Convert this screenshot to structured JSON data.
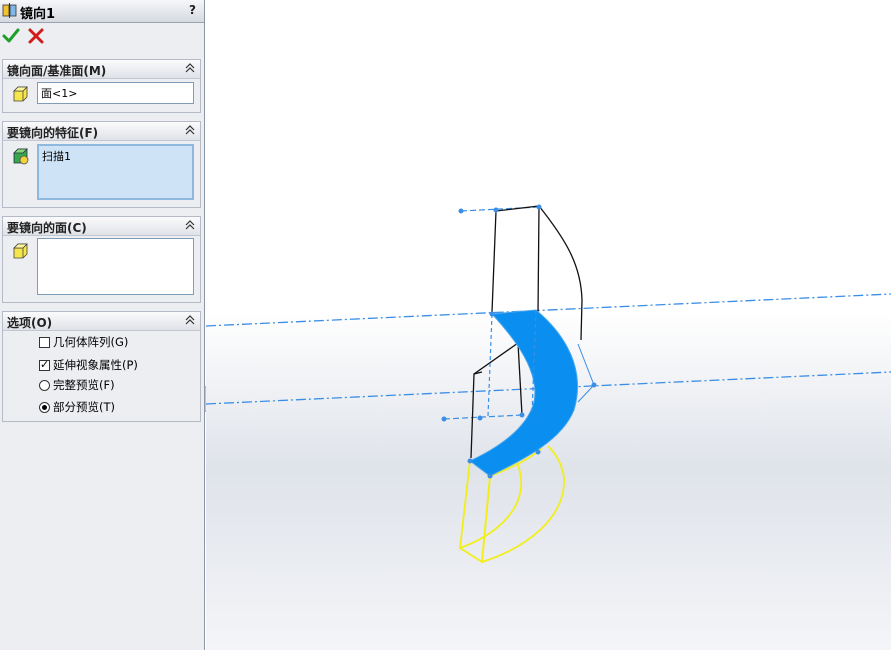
{
  "window": {
    "title": "镜向1",
    "help_label": "?"
  },
  "actions": {
    "ok": "ok-checkmark",
    "cancel": "cancel-x"
  },
  "groups": {
    "mirror_face": {
      "title": "镜向面/基准面(M)",
      "value": "面<1>"
    },
    "features": {
      "title": "要镜向的特征(F)",
      "items": [
        "扫描1"
      ]
    },
    "faces": {
      "title": "要镜向的面(C)",
      "items": []
    },
    "options": {
      "title": "选项(O)",
      "geometry_pattern": {
        "label": "几何体阵列(G)",
        "checked": false
      },
      "propagate_visual": {
        "label": "延伸视象属性(P)",
        "checked": true
      },
      "full_preview": {
        "label": "完整预览(F)",
        "selected": false
      },
      "partial_preview": {
        "label": "部分预览(T)",
        "selected": true
      }
    }
  },
  "colors": {
    "selected_face": "#0a8ff0",
    "preview": "#f2ee1a",
    "edge": "#111111",
    "axis": "#3a8ee6",
    "panel_bg": "#eceef2"
  }
}
